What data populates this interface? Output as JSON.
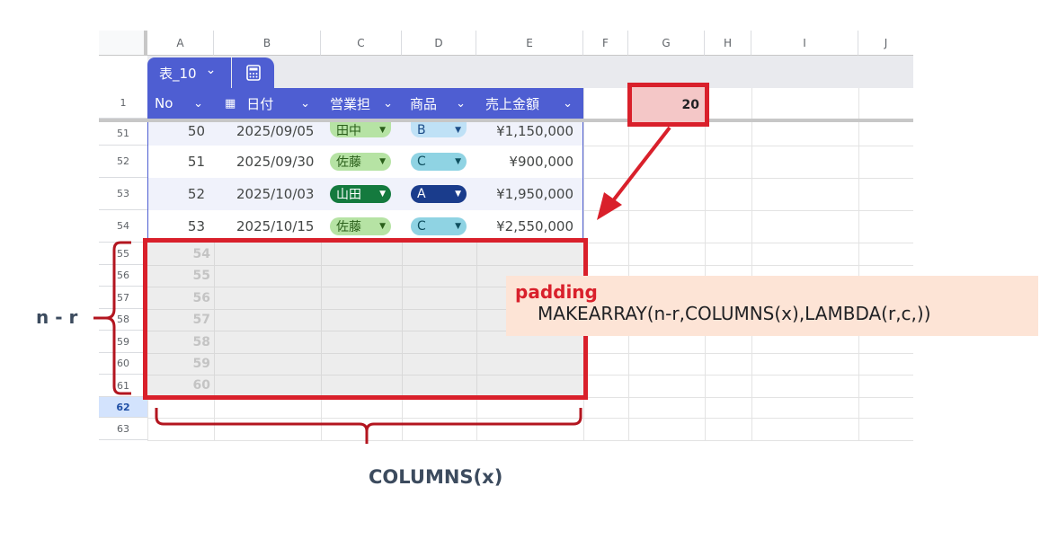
{
  "columns": [
    "A",
    "B",
    "C",
    "D",
    "E",
    "F",
    "G",
    "H",
    "I",
    "J"
  ],
  "rows": [
    "1",
    "51",
    "52",
    "53",
    "54",
    "55",
    "56",
    "57",
    "58",
    "59",
    "60",
    "61",
    "62",
    "63"
  ],
  "table_tab": {
    "name": "表_10",
    "chevron": "⌄"
  },
  "headers": [
    "No",
    "日付",
    "営業担",
    "商品",
    "売上金額"
  ],
  "data_rows": [
    {
      "no": "50",
      "date": "2025/09/05",
      "person": "田中",
      "product": "B",
      "amount": "¥1,150,000"
    },
    {
      "no": "51",
      "date": "2025/09/30",
      "person": "佐藤",
      "product": "C",
      "amount": "¥900,000"
    },
    {
      "no": "52",
      "date": "2025/10/03",
      "person": "山田",
      "product": "A",
      "amount": "¥1,950,000"
    },
    {
      "no": "53",
      "date": "2025/10/15",
      "person": "佐藤",
      "product": "C",
      "amount": "¥2,550,000"
    }
  ],
  "padding_numbers": [
    "54",
    "55",
    "56",
    "57",
    "58",
    "59",
    "60"
  ],
  "g1_value": "20",
  "annotation": {
    "title": "padding",
    "formula": "MAKEARRAY(n-r,COLUMNS(x),LAMBDA(r,c,))"
  },
  "n_r_label": "n - r",
  "columns_label": "COLUMNS(x)",
  "colors": {
    "table_header": "#4e5ed2",
    "highlight_red": "#d9202b",
    "annotation_bg": "#fde4d6",
    "label_text": "#3c4b5e",
    "chip_green": "#b6e3a4",
    "chip_darkgreen": "#147a3e",
    "chip_lightblue": "#bfe1f6",
    "chip_teal": "#8fd3e3",
    "chip_navy": "#1a3c8c"
  }
}
